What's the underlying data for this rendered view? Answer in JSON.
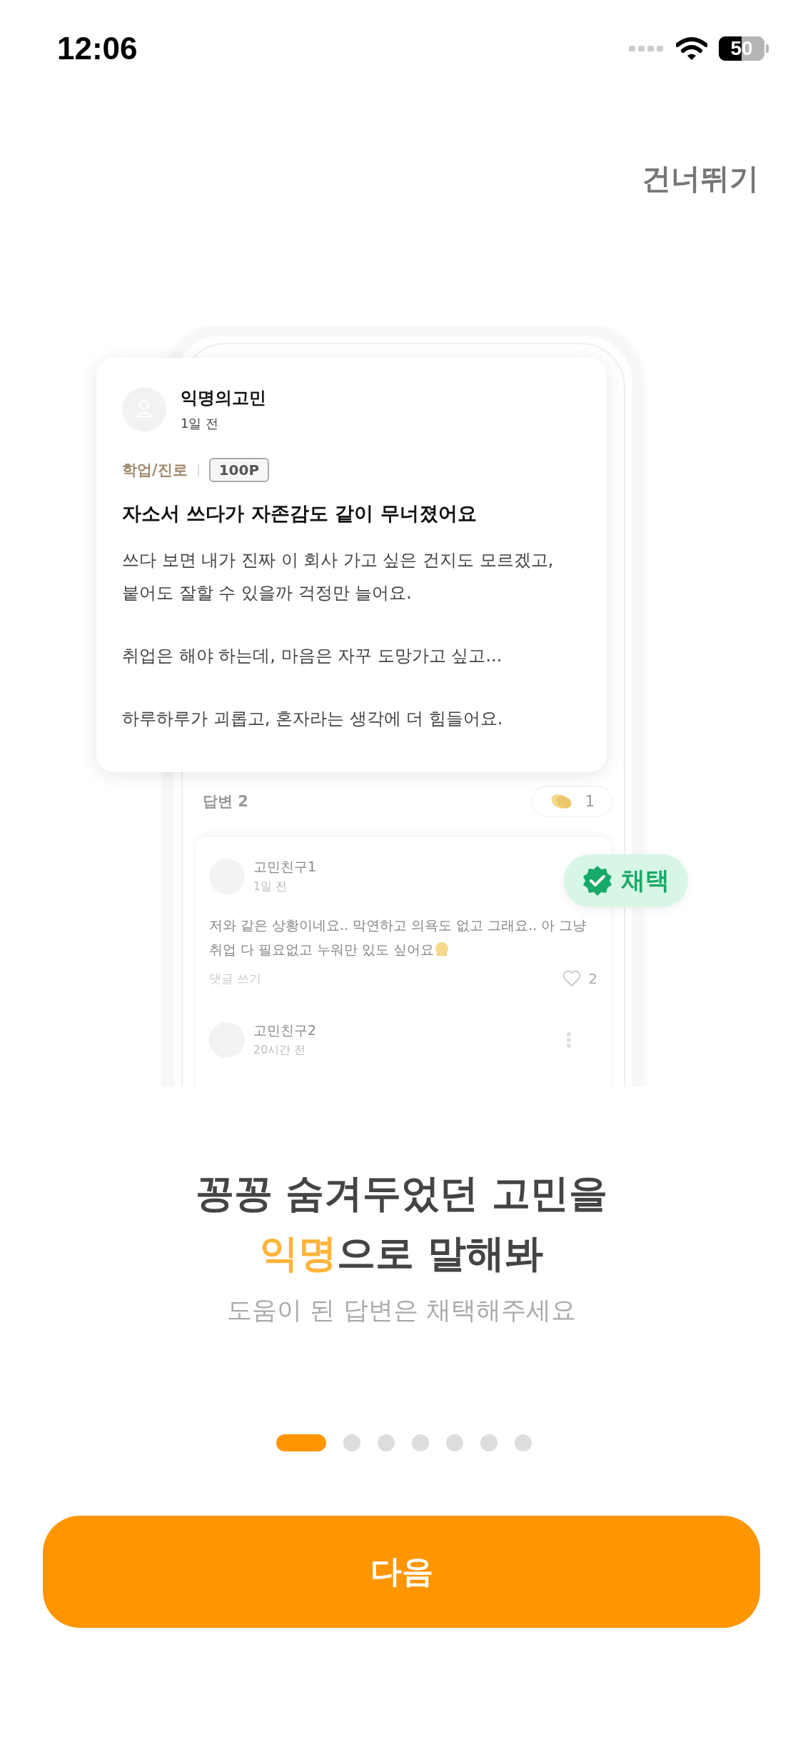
{
  "status_bar": {
    "time": "12:06",
    "battery": "50"
  },
  "skip": "건너뛰기",
  "post": {
    "author": "익명의고민",
    "time": "1일 전",
    "category": "학업/진로",
    "points": "100P",
    "title": "자소서 쓰다가 자존감도 같이 무너졌어요",
    "paragraphs": [
      {
        "lines": [
          "쓰다 보면 내가 진짜 이 회사 가고 싶은 건지도 모르겠고,",
          "붙어도 잘할 수 있을까 걱정만 늘어요."
        ]
      },
      {
        "lines": [
          "취업은 해야 하는데, 마음은 자꾸 도망가고 싶고..."
        ]
      },
      {
        "lines": [
          "하루하루가 괴롭고, 혼자라는 생각에 더 힘들어요."
        ]
      }
    ]
  },
  "answers_header": {
    "label": "답변 2",
    "clap_count": "1"
  },
  "answers": [
    {
      "author": "고민친구1",
      "time": "1일 전",
      "lines": [
        "저와 같은 상황이네요.. 막연하고 의욕도 없고 그래요.. 아 그냥",
        "취업 다 필요없고 누워만 있도 싶어요"
      ],
      "emoji": true,
      "reply": "댓글 쓰기",
      "likes": "2",
      "menu": false
    },
    {
      "author": "고민친구2",
      "time": "20시간 전",
      "menu": true
    }
  ],
  "accepted_badge": "채택",
  "headline": {
    "line1": "꽁꽁 숨겨두었던 고민을",
    "highlight": "익명",
    "rest": "으로 말해봐"
  },
  "subtitle": "도움이 된 답변은 채택해주세요",
  "pager": [
    {
      "selected": true
    },
    {
      "selected": false
    },
    {
      "selected": false
    },
    {
      "selected": false
    },
    {
      "selected": false
    },
    {
      "selected": false
    },
    {
      "selected": false
    }
  ],
  "next_button": "다음"
}
